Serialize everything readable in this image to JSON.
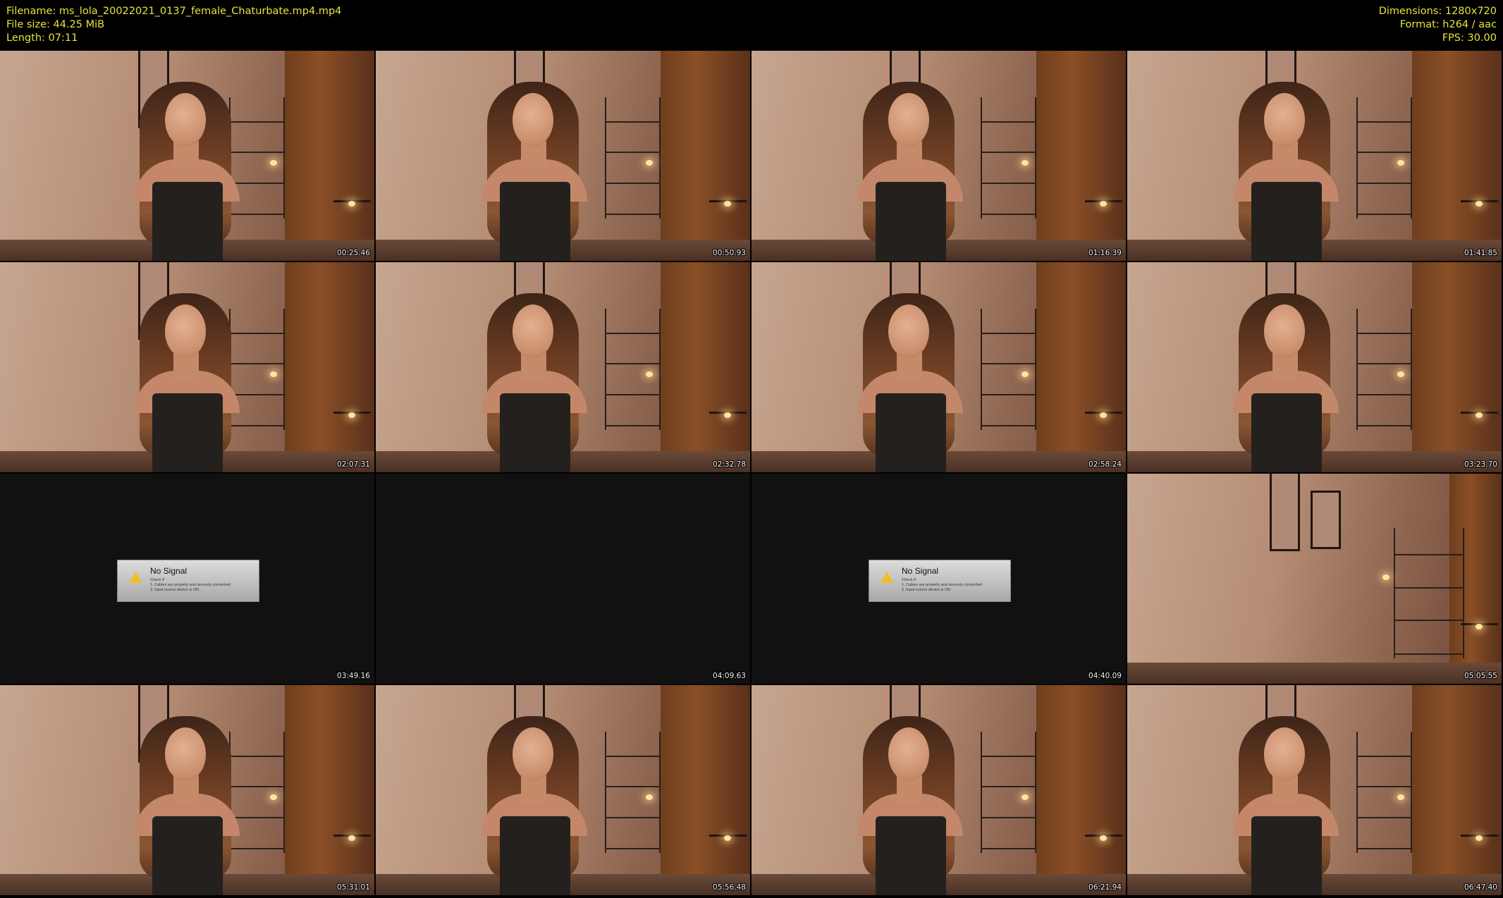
{
  "header": {
    "filename_label": "Filename: ms_lola_20022021_0137_female_Chaturbate.mp4.mp4",
    "filesize_label": "File size: 44.25 MiB",
    "length_label": "Length: 07:11",
    "dimensions_label": "Dimensions: 1280x720",
    "format_label": "Format: h264 / aac",
    "fps_label": "FPS: 30.00"
  },
  "colors": {
    "background": "#000000",
    "info_text": "#e6e43c",
    "timestamp_text": "#f0f0f0",
    "no_signal_frame": "#111111"
  },
  "thumbnails": [
    {
      "timestamp": "00:25.46",
      "kind": "person"
    },
    {
      "timestamp": "00:50.93",
      "kind": "person"
    },
    {
      "timestamp": "01:16.39",
      "kind": "person"
    },
    {
      "timestamp": "01:41.85",
      "kind": "person"
    },
    {
      "timestamp": "02:07.31",
      "kind": "person"
    },
    {
      "timestamp": "02:32.78",
      "kind": "person"
    },
    {
      "timestamp": "02:58.24",
      "kind": "person"
    },
    {
      "timestamp": "03:23.70",
      "kind": "person"
    },
    {
      "timestamp": "03:49.16",
      "kind": "no-signal"
    },
    {
      "timestamp": "04:09.63",
      "kind": "blank"
    },
    {
      "timestamp": "04:40.09",
      "kind": "no-signal"
    },
    {
      "timestamp": "05:05.55",
      "kind": "empty-room"
    },
    {
      "timestamp": "05:31.01",
      "kind": "person"
    },
    {
      "timestamp": "05:56.48",
      "kind": "person"
    },
    {
      "timestamp": "06:21.94",
      "kind": "person"
    },
    {
      "timestamp": "06:47.40",
      "kind": "person"
    }
  ],
  "no_signal": {
    "title": "No Signal",
    "check": "Check if",
    "line1": "1. Cables are properly and securely connected",
    "line2": "2. Input source device is ON",
    "icon": "warning-icon"
  }
}
